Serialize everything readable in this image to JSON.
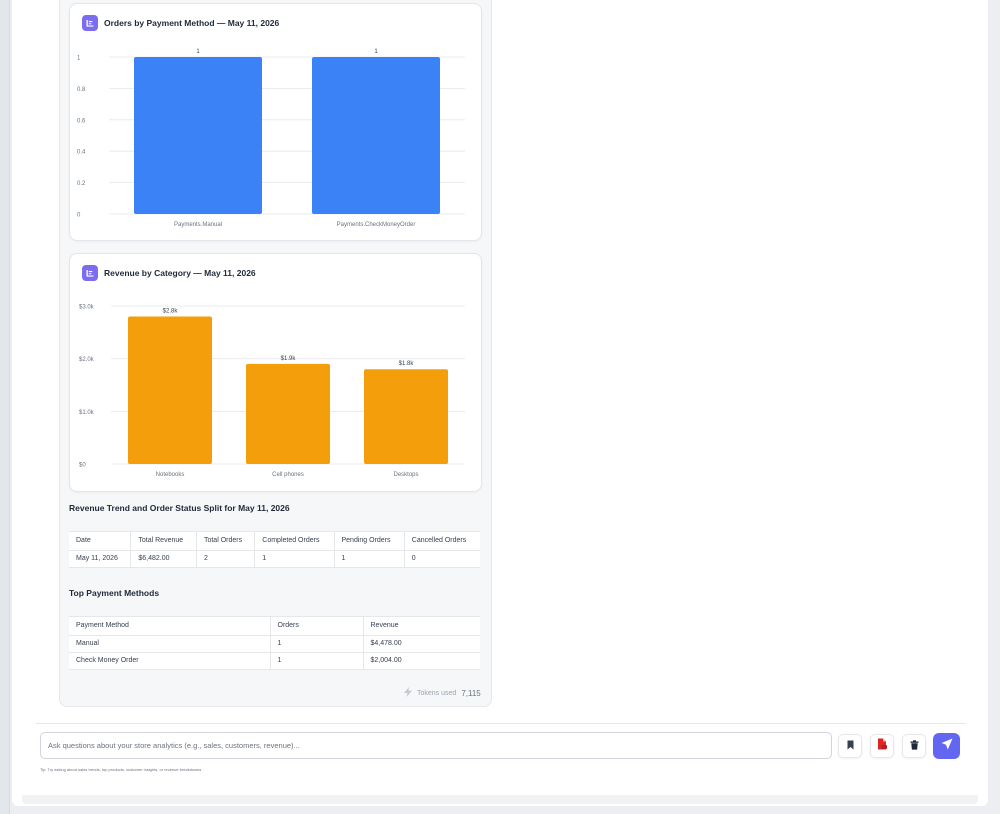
{
  "colors": {
    "accent": "#6366f1",
    "card_icon": "#7c6cf0",
    "payment_bar": "#3b82f6",
    "category_bar": "#f59e0b"
  },
  "charts": {
    "payment": {
      "title": "Orders by Payment Method — May 11, 2026"
    },
    "category": {
      "title": "Revenue by Category — May 11, 2026"
    }
  },
  "chart_data": [
    {
      "type": "bar",
      "title": "Orders by Payment Method — May 11, 2026",
      "categories": [
        "Payments.Manual",
        "Payments.CheckMoneyOrder"
      ],
      "values": [
        1,
        1
      ],
      "value_labels": [
        "1",
        "1"
      ],
      "ylim": [
        0,
        1
      ],
      "yticks": [
        "0",
        "0.2",
        "0.4",
        "0.6",
        "0.8",
        "1"
      ],
      "grid": true,
      "xlabel": "",
      "ylabel": ""
    },
    {
      "type": "bar",
      "title": "Revenue by Category — May 11, 2026",
      "categories": [
        "Notebooks",
        "Cell phones",
        "Desktops"
      ],
      "values": [
        2800,
        1900,
        1800
      ],
      "value_labels": [
        "$2.8k",
        "$1.9k",
        "$1.8k"
      ],
      "ylim": [
        0,
        3000
      ],
      "yticks": [
        "$0",
        "$1.0k",
        "$2.0k",
        "$3.0k"
      ],
      "grid": true,
      "xlabel": "",
      "ylabel": ""
    }
  ],
  "trend_section": {
    "heading": "Revenue Trend and Order Status Split for May 11, 2026",
    "columns": [
      "Date",
      "Total Revenue",
      "Total Orders",
      "Completed Orders",
      "Pending Orders",
      "Cancelled Orders"
    ],
    "rows": [
      [
        "May 11, 2026",
        "$6,482.00",
        "2",
        "1",
        "1",
        "0"
      ]
    ]
  },
  "payment_section": {
    "heading": "Top Payment Methods",
    "columns": [
      "Payment Method",
      "Orders",
      "Revenue"
    ],
    "rows": [
      [
        "Manual",
        "1",
        "$4,478.00"
      ],
      [
        "Check Money Order",
        "1",
        "$2,004.00"
      ]
    ]
  },
  "tokens": {
    "label": "Tokens used",
    "count": "7,115"
  },
  "composer": {
    "placeholder": "Ask questions about your store analytics (e.g., sales, customers, revenue)...",
    "tip": "Tip: Try asking about sales trends, top products, customer insights, or revenue breakdowns"
  },
  "icons": {
    "card": "bar-chart-icon",
    "tokens": "lightning-icon",
    "bookmark": "bookmark-icon",
    "pdf": "pdf-icon",
    "trash": "trash-icon",
    "send": "send-icon"
  }
}
